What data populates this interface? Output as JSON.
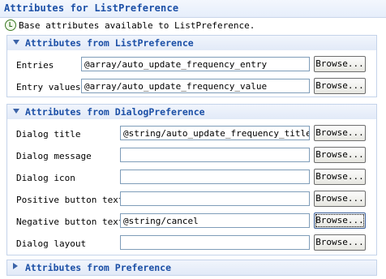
{
  "page": {
    "title": "Attributes for ListPreference",
    "info_icon": "L",
    "info_text": "Base attributes available to ListPreference."
  },
  "sections": [
    {
      "title": "Attributes from ListPreference",
      "expanded": true,
      "fields": [
        {
          "label": "Entries",
          "value": "@array/auto_update_frequency_entry",
          "button": "Browse..."
        },
        {
          "label": "Entry values",
          "value": "@array/auto_update_frequency_value",
          "button": "Browse..."
        }
      ]
    },
    {
      "title": "Attributes from DialogPreference",
      "expanded": true,
      "fields": [
        {
          "label": "Dialog title",
          "value": "@string/auto_update_frequency_title",
          "button": "Browse..."
        },
        {
          "label": "Dialog message",
          "value": "",
          "button": "Browse..."
        },
        {
          "label": "Dialog icon",
          "value": "",
          "button": "Browse..."
        },
        {
          "label": "Positive button text",
          "value": "",
          "button": "Browse..."
        },
        {
          "label": "Negative button text",
          "value": "@string/cancel",
          "button": "Browse..."
        },
        {
          "label": "Dialog layout",
          "value": "",
          "button": "Browse..."
        }
      ]
    },
    {
      "title": "Attributes from Preference",
      "expanded": false,
      "fields": []
    }
  ],
  "colors": {
    "accent": "#1b4fa6",
    "header_bg": "#e6eefb",
    "border": "#c4d3ea"
  }
}
